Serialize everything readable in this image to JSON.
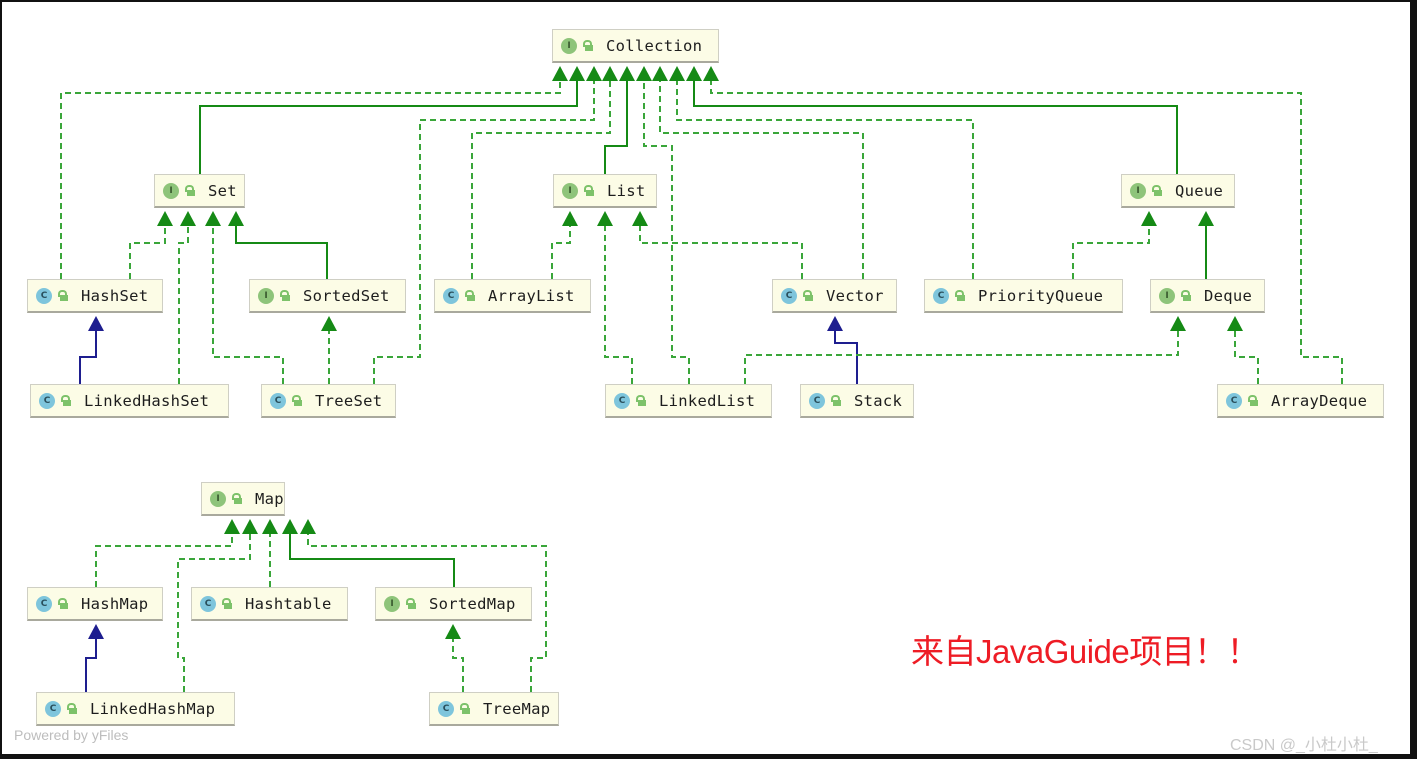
{
  "diagram": {
    "colors": {
      "inherit_interface": "#158a15",
      "implement_dashed": "#3aa63a",
      "extends_class": "#1e1e8f",
      "note_text": "#ee1c25",
      "node_bg": "#fcfce6"
    },
    "nodes": {
      "collection": {
        "label": "Collection",
        "kind": "interface",
        "badge": "I"
      },
      "set": {
        "label": "Set",
        "kind": "interface",
        "badge": "I"
      },
      "list": {
        "label": "List",
        "kind": "interface",
        "badge": "I"
      },
      "queue": {
        "label": "Queue",
        "kind": "interface",
        "badge": "I"
      },
      "hashset": {
        "label": "HashSet",
        "kind": "class",
        "badge": "C"
      },
      "sortedset": {
        "label": "SortedSet",
        "kind": "interface",
        "badge": "I"
      },
      "arraylist": {
        "label": "ArrayList",
        "kind": "class",
        "badge": "C"
      },
      "vector": {
        "label": "Vector",
        "kind": "class",
        "badge": "C"
      },
      "priorityqueue": {
        "label": "PriorityQueue",
        "kind": "class",
        "badge": "C"
      },
      "deque": {
        "label": "Deque",
        "kind": "interface",
        "badge": "I"
      },
      "linkedhashset": {
        "label": "LinkedHashSet",
        "kind": "class",
        "badge": "C"
      },
      "treeset": {
        "label": "TreeSet",
        "kind": "class",
        "badge": "C"
      },
      "linkedlist": {
        "label": "LinkedList",
        "kind": "class",
        "badge": "C"
      },
      "stack": {
        "label": "Stack",
        "kind": "class",
        "badge": "C"
      },
      "arraydeque": {
        "label": "ArrayDeque",
        "kind": "class",
        "badge": "C"
      },
      "map": {
        "label": "Map",
        "kind": "interface",
        "badge": "I"
      },
      "hashmap": {
        "label": "HashMap",
        "kind": "class",
        "badge": "C"
      },
      "hashtable": {
        "label": "Hashtable",
        "kind": "class",
        "badge": "C"
      },
      "sortedmap": {
        "label": "SortedMap",
        "kind": "interface",
        "badge": "I"
      },
      "linkedhashmap": {
        "label": "LinkedHashMap",
        "kind": "class",
        "badge": "C"
      },
      "treemap": {
        "label": "TreeMap",
        "kind": "class",
        "badge": "C"
      }
    },
    "edges": [
      {
        "from": "hashset",
        "to": "collection",
        "type": "implements"
      },
      {
        "from": "set",
        "to": "collection",
        "type": "extends-interface"
      },
      {
        "from": "treeset",
        "to": "collection",
        "type": "implements"
      },
      {
        "from": "arraylist",
        "to": "collection",
        "type": "implements"
      },
      {
        "from": "list",
        "to": "collection",
        "type": "extends-interface"
      },
      {
        "from": "linkedlist",
        "to": "collection",
        "type": "implements"
      },
      {
        "from": "vector",
        "to": "collection",
        "type": "implements"
      },
      {
        "from": "priorityqueue",
        "to": "collection",
        "type": "implements"
      },
      {
        "from": "queue",
        "to": "collection",
        "type": "extends-interface"
      },
      {
        "from": "arraydeque",
        "to": "collection",
        "type": "implements"
      },
      {
        "from": "hashset",
        "to": "set",
        "type": "implements"
      },
      {
        "from": "linkedhashset",
        "to": "set",
        "type": "implements"
      },
      {
        "from": "treeset",
        "to": "set",
        "type": "implements"
      },
      {
        "from": "sortedset",
        "to": "set",
        "type": "extends-interface"
      },
      {
        "from": "linkedhashset",
        "to": "hashset",
        "type": "extends-class"
      },
      {
        "from": "treeset",
        "to": "sortedset",
        "type": "implements"
      },
      {
        "from": "arraylist",
        "to": "list",
        "type": "implements"
      },
      {
        "from": "linkedlist",
        "to": "list",
        "type": "implements"
      },
      {
        "from": "vector",
        "to": "list",
        "type": "implements"
      },
      {
        "from": "stack",
        "to": "vector",
        "type": "extends-class"
      },
      {
        "from": "priorityqueue",
        "to": "queue",
        "type": "implements"
      },
      {
        "from": "deque",
        "to": "queue",
        "type": "extends-interface"
      },
      {
        "from": "linkedlist",
        "to": "deque",
        "type": "implements"
      },
      {
        "from": "arraydeque",
        "to": "deque",
        "type": "implements"
      },
      {
        "from": "hashmap",
        "to": "map",
        "type": "implements"
      },
      {
        "from": "linkedhashmap",
        "to": "map",
        "type": "implements"
      },
      {
        "from": "hashtable",
        "to": "map",
        "type": "implements"
      },
      {
        "from": "sortedmap",
        "to": "map",
        "type": "extends-interface"
      },
      {
        "from": "treemap",
        "to": "map",
        "type": "implements"
      },
      {
        "from": "linkedhashmap",
        "to": "hashmap",
        "type": "extends-class"
      },
      {
        "from": "treemap",
        "to": "sortedmap",
        "type": "implements"
      }
    ],
    "note": "来自JavaGuide项目！！",
    "watermark_yfiles": "Powered by yFiles",
    "watermark_csdn": "CSDN @_小杜小杜_"
  }
}
